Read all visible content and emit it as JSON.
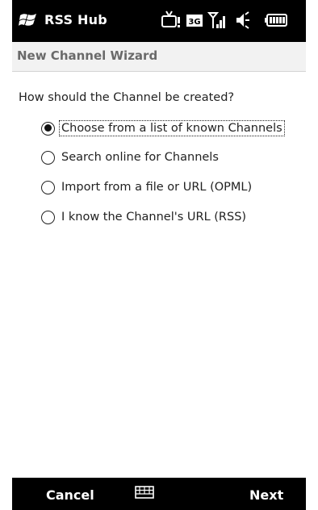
{
  "status_bar": {
    "app_title": "RSS Hub",
    "icons": [
      "windows-start-icon",
      "tv-notification-icon",
      "3g-icon",
      "signal-icon",
      "speaker-icon",
      "battery-icon"
    ]
  },
  "wizard": {
    "title": "New Channel Wizard"
  },
  "main": {
    "question": "How should the Channel be created?",
    "options": [
      {
        "label": "Choose from a list of known Channels",
        "selected": true
      },
      {
        "label": "Search online for Channels",
        "selected": false
      },
      {
        "label": "Import from a file or URL (OPML)",
        "selected": false
      },
      {
        "label": "I know the Channel's URL (RSS)",
        "selected": false
      }
    ]
  },
  "softkeys": {
    "left": "Cancel",
    "center_icon": "keyboard-icon",
    "right": "Next"
  },
  "colors": {
    "bar_background": "#000000",
    "header_background": "#f2f2f2",
    "header_text": "#6a6a6a"
  }
}
